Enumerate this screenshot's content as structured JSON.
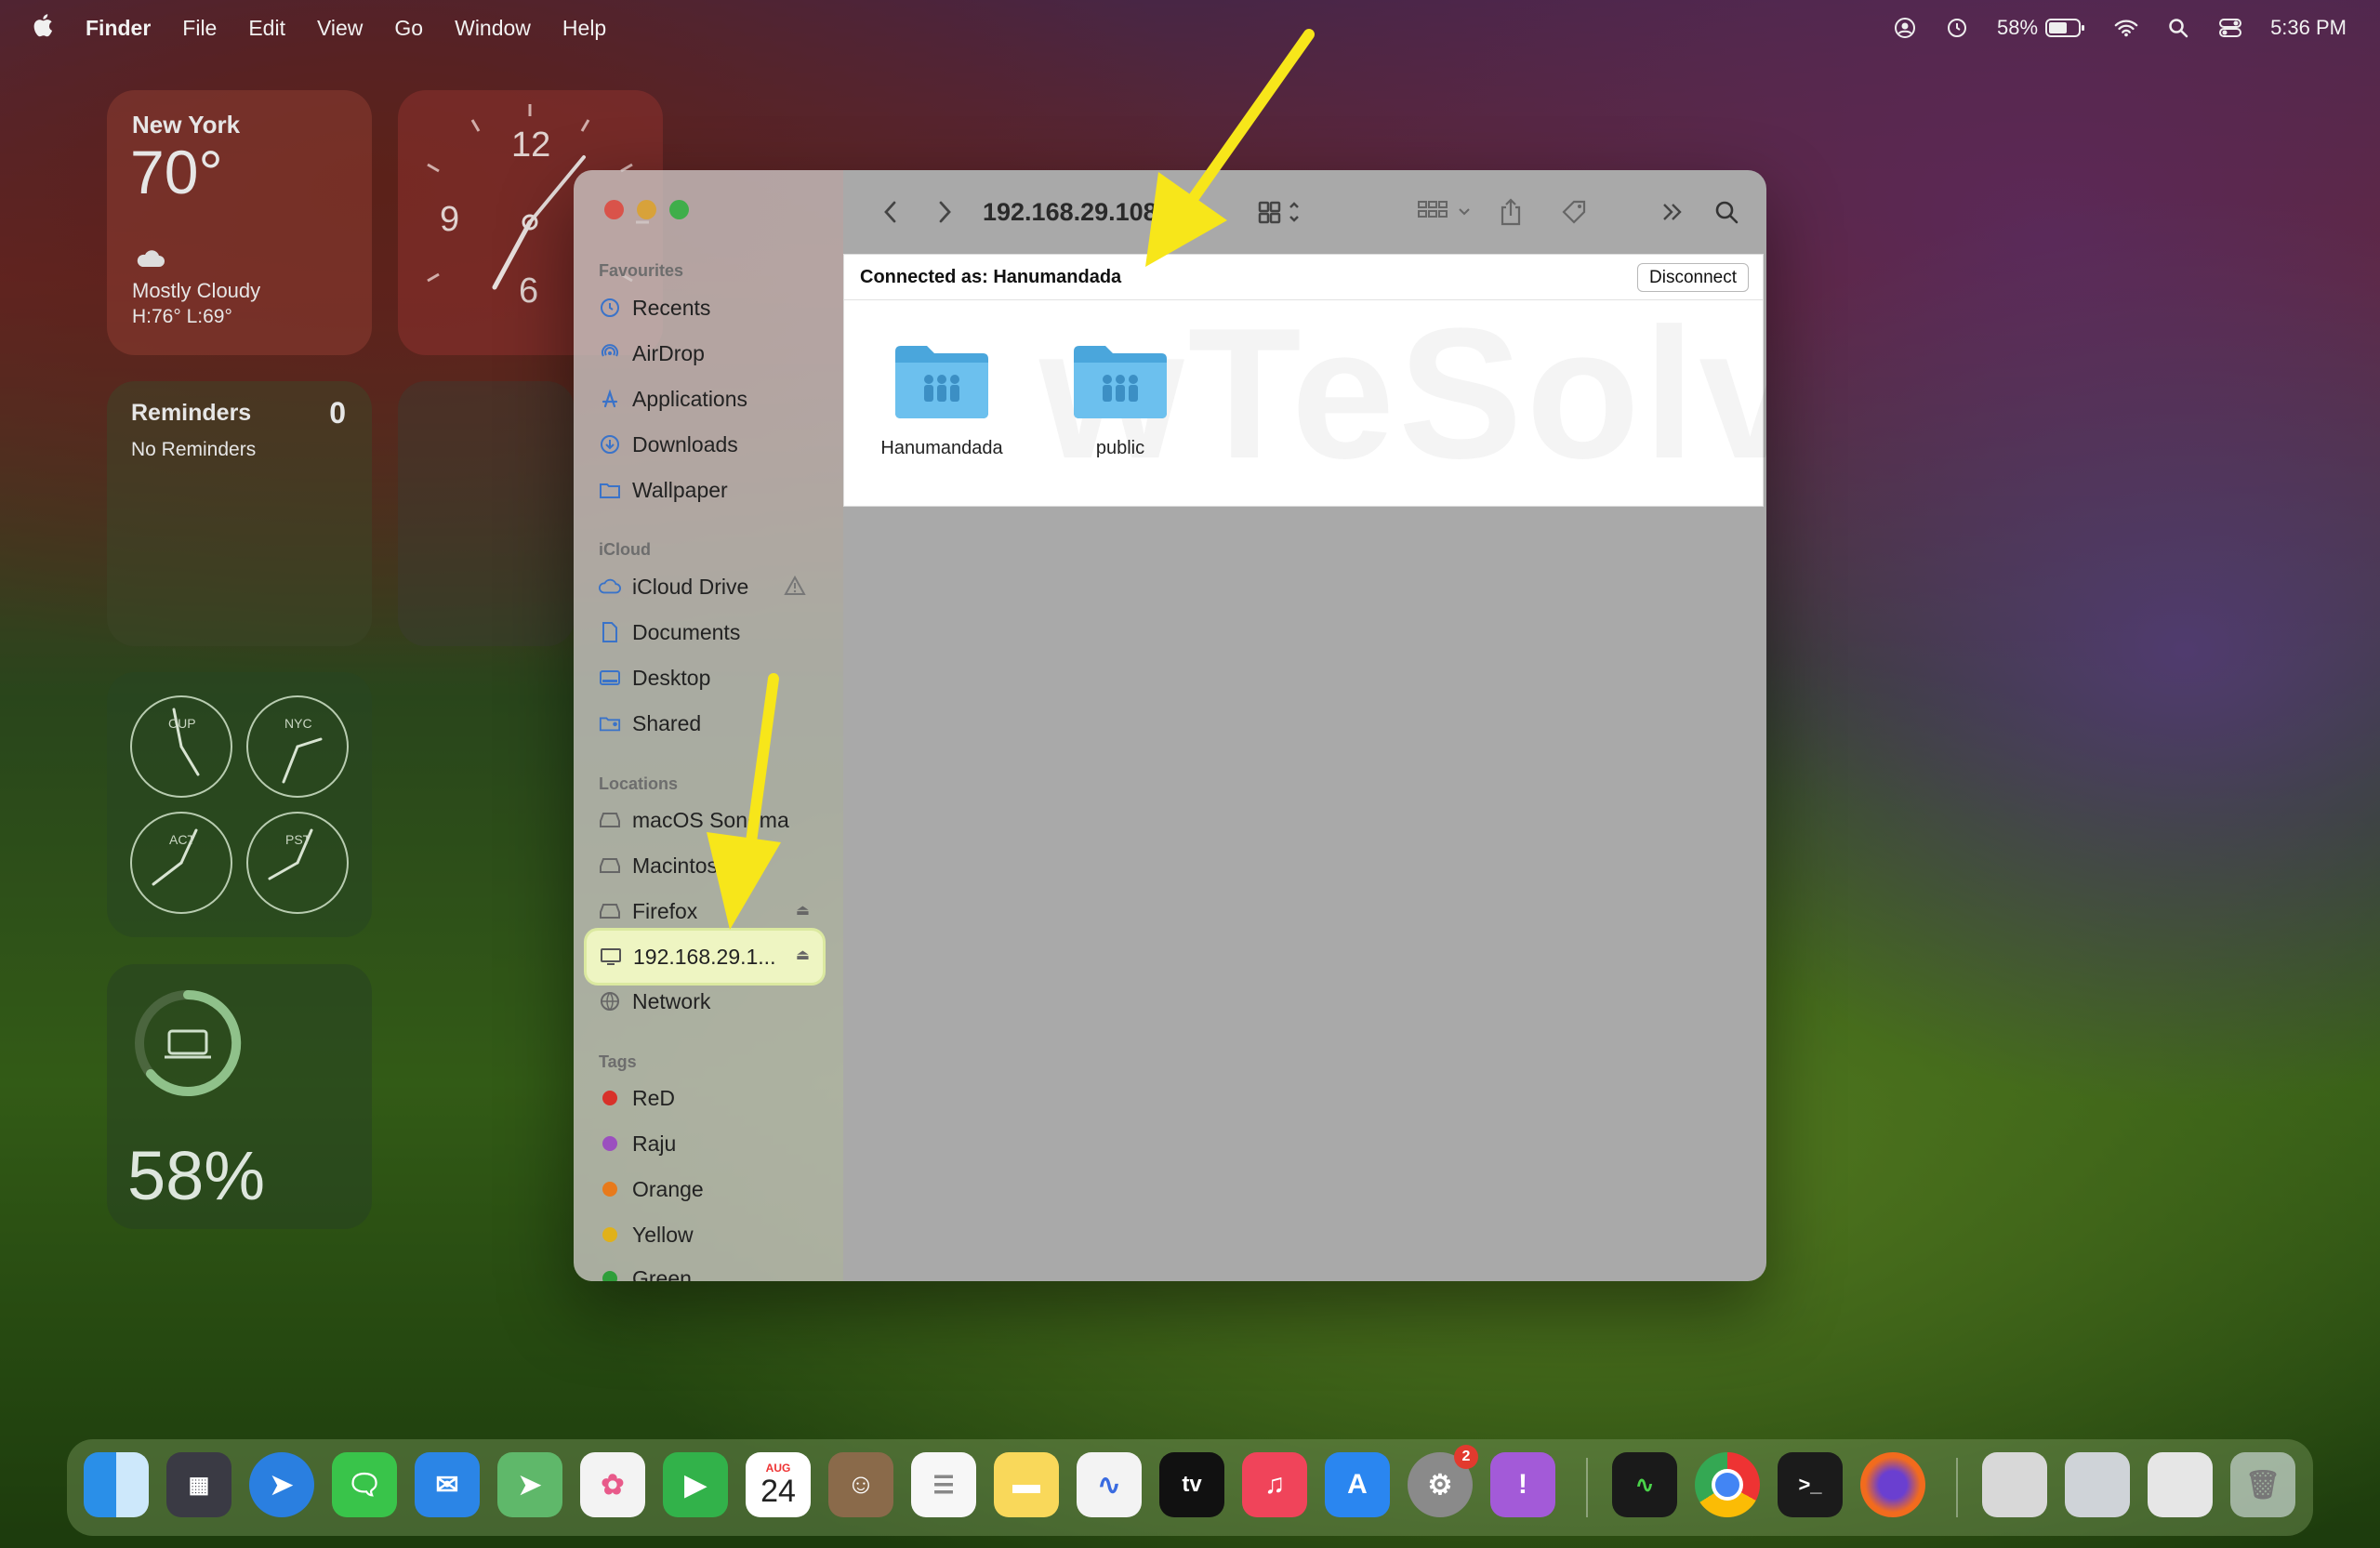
{
  "menubar": {
    "app": "Finder",
    "items": [
      "File",
      "Edit",
      "View",
      "Go",
      "Window",
      "Help"
    ],
    "battery": "58%",
    "time": "5:36 PM"
  },
  "widgets": {
    "weather": {
      "city": "New York",
      "temp": "70°",
      "condition": "Mostly Cloudy",
      "hilo": "H:76° L:69°"
    },
    "clock": {
      "numerals": [
        "12",
        "9",
        "6"
      ]
    },
    "reminders": {
      "title": "Reminders",
      "count": "0",
      "empty": "No Reminders"
    },
    "world_clocks": [
      "CUP",
      "NYC",
      "ACT",
      "PST"
    ],
    "battery": {
      "percent": "58%"
    }
  },
  "finder": {
    "path_title": "192.168.29.108",
    "sidebar": {
      "favourites_title": "Favourites",
      "favourites": [
        "Recents",
        "AirDrop",
        "Applications",
        "Downloads",
        "Wallpaper"
      ],
      "icloud_title": "iCloud",
      "icloud": [
        "iCloud Drive",
        "Documents",
        "Desktop",
        "Shared"
      ],
      "locations_title": "Locations",
      "locations": [
        "macOS Sonoma",
        "Macintosh HD",
        "Firefox",
        "192.168.29.1...",
        "Network"
      ],
      "tags_title": "Tags",
      "tags": [
        {
          "name": "ReD",
          "color": "#d8312a"
        },
        {
          "name": "Raju",
          "color": "#9b4fbf"
        },
        {
          "name": "Orange",
          "color": "#e87a1c"
        },
        {
          "name": "Yellow",
          "color": "#e0b11a"
        },
        {
          "name": "Green",
          "color": "#2e9e3a"
        }
      ]
    },
    "connected_as": "Connected as: Hanumandada",
    "disconnect_label": "Disconnect",
    "folders": [
      "Hanumandada",
      "public"
    ],
    "watermark": "wTeSolve.com"
  },
  "dock": {
    "calendar_month": "AUG",
    "calendar_day": "24",
    "settings_badge": "2"
  },
  "colors": {
    "arrow": "#f7e61a",
    "folder": "#5fb7e8",
    "selection": "#eef5c2"
  }
}
